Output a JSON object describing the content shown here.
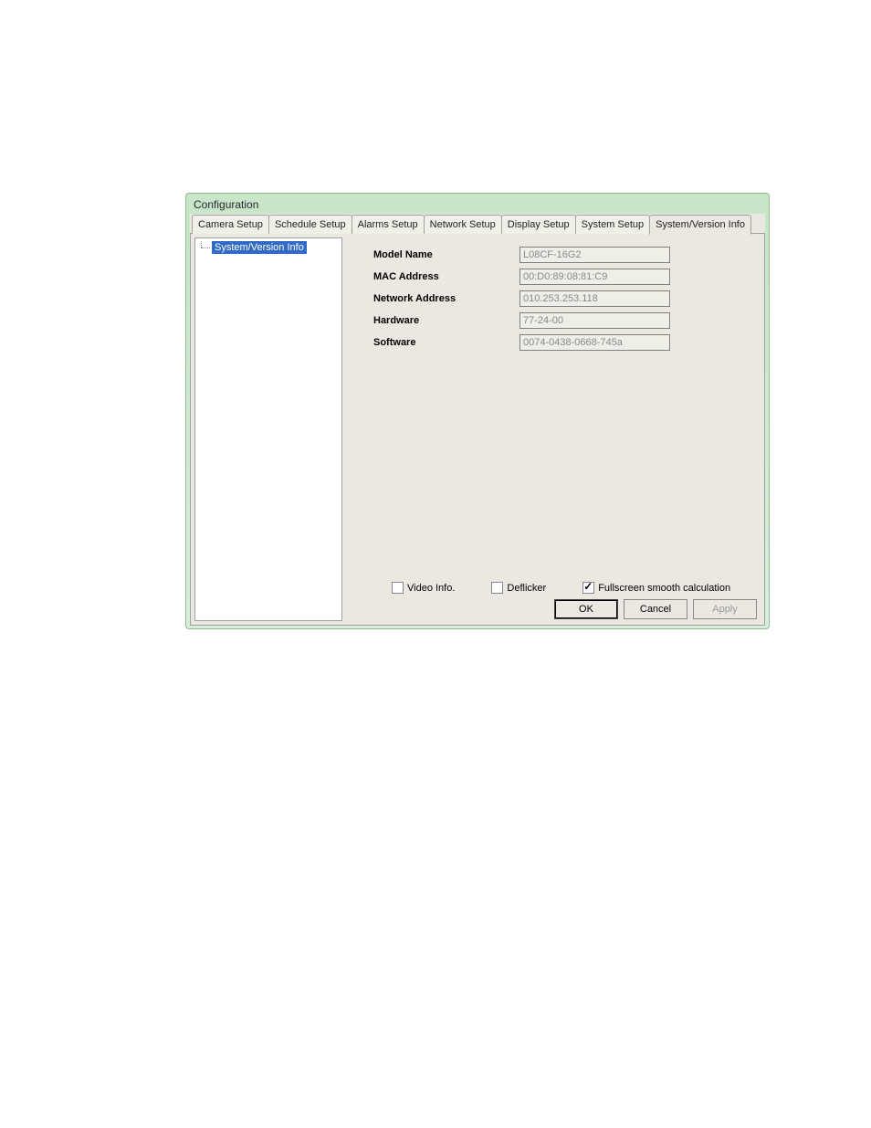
{
  "dialog": {
    "title": "Configuration"
  },
  "tabs": [
    {
      "label": "Camera Setup"
    },
    {
      "label": "Schedule Setup"
    },
    {
      "label": "Alarms Setup"
    },
    {
      "label": "Network Setup"
    },
    {
      "label": "Display Setup"
    },
    {
      "label": "System Setup"
    },
    {
      "label": "System/Version Info"
    }
  ],
  "tree": {
    "item": "System/Version Info"
  },
  "fields": {
    "model_name": {
      "label": "Model Name",
      "value": "L08CF-16G2"
    },
    "mac_address": {
      "label": "MAC Address",
      "value": "00:D0:89:08:81:C9"
    },
    "network_address": {
      "label": "Network Address",
      "value": "010.253.253.118"
    },
    "hardware": {
      "label": "Hardware",
      "value": "77-24-00"
    },
    "software": {
      "label": "Software",
      "value": "0074-0438-0668-745a"
    }
  },
  "options": {
    "video_info": {
      "label": "Video Info.",
      "checked": false
    },
    "deflicker": {
      "label": "Deflicker",
      "checked": false
    },
    "fullscreen_smooth": {
      "label": "Fullscreen smooth calculation",
      "checked": true
    }
  },
  "buttons": {
    "ok": "OK",
    "cancel": "Cancel",
    "apply": "Apply"
  }
}
